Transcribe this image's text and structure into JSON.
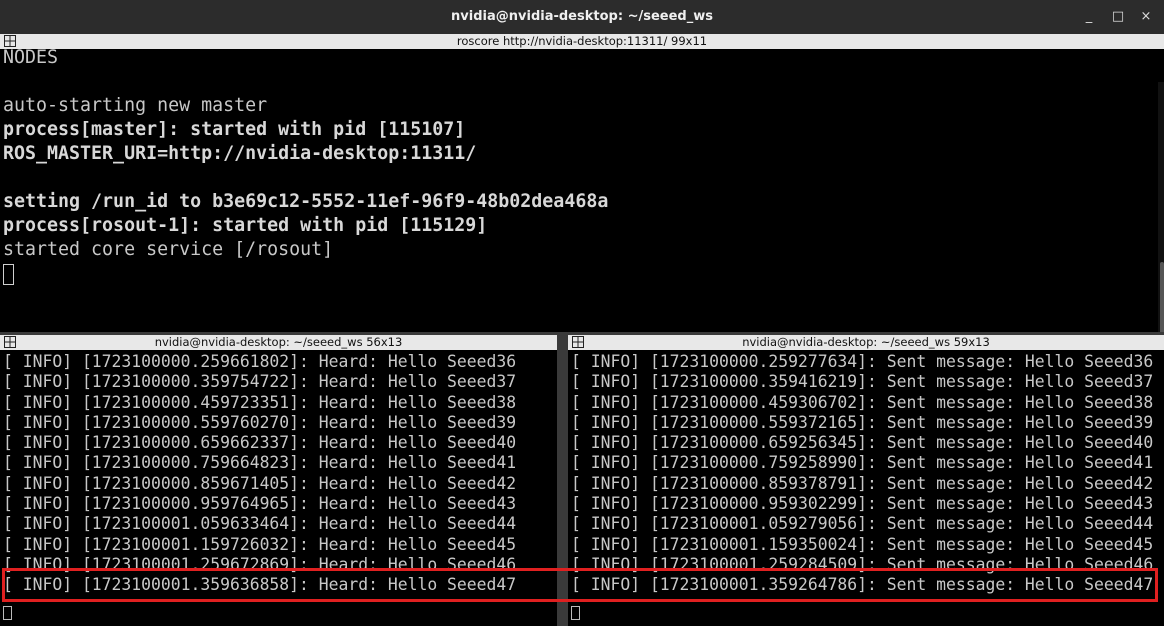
{
  "window": {
    "title": "nvidia@nvidia-desktop: ~/seeed_ws",
    "buttons": {
      "close": "×",
      "minimize": "_",
      "maximize": "□"
    }
  },
  "panes": {
    "top": {
      "header": "roscore http://nvidia-desktop:11311/ 99x11",
      "lines": [
        {
          "text": "NODES",
          "bold": false
        },
        {
          "text": "",
          "bold": false
        },
        {
          "text": "auto-starting new master",
          "bold": false
        },
        {
          "text": "process[master]: started with pid [115107]",
          "bold": true
        },
        {
          "text": "ROS_MASTER_URI=http://nvidia-desktop:11311/",
          "bold": true
        },
        {
          "text": "",
          "bold": false
        },
        {
          "text": "setting /run_id to b3e69c12-5552-11ef-96f9-48b02dea468a",
          "bold": true
        },
        {
          "text": "process[rosout-1]: started with pid [115129]",
          "bold": true
        },
        {
          "text": "started core service [/rosout]",
          "bold": false
        }
      ]
    },
    "left": {
      "header": "nvidia@nvidia-desktop: ~/seeed_ws 56x13",
      "lines": [
        "[ INFO] [1723100000.259661802]: Heard: Hello Seeed36",
        "[ INFO] [1723100000.359754722]: Heard: Hello Seeed37",
        "[ INFO] [1723100000.459723351]: Heard: Hello Seeed38",
        "[ INFO] [1723100000.559760270]: Heard: Hello Seeed39",
        "[ INFO] [1723100000.659662337]: Heard: Hello Seeed40",
        "[ INFO] [1723100000.759664823]: Heard: Hello Seeed41",
        "[ INFO] [1723100000.859671405]: Heard: Hello Seeed42",
        "[ INFO] [1723100000.959764965]: Heard: Hello Seeed43",
        "[ INFO] [1723100001.059633464]: Heard: Hello Seeed44",
        "[ INFO] [1723100001.159726032]: Heard: Hello Seeed45",
        "[ INFO] [1723100001.259672869]: Heard: Hello Seeed46",
        "[ INFO] [1723100001.359636858]: Heard: Hello Seeed47"
      ]
    },
    "right": {
      "header": "nvidia@nvidia-desktop: ~/seeed_ws 59x13",
      "lines": [
        "[ INFO] [1723100000.259277634]: Sent message: Hello Seeed36",
        "[ INFO] [1723100000.359416219]: Sent message: Hello Seeed37",
        "[ INFO] [1723100000.459306702]: Sent message: Hello Seeed38",
        "[ INFO] [1723100000.559372165]: Sent message: Hello Seeed39",
        "[ INFO] [1723100000.659256345]: Sent message: Hello Seeed40",
        "[ INFO] [1723100000.759258990]: Sent message: Hello Seeed41",
        "[ INFO] [1723100000.859378791]: Sent message: Hello Seeed42",
        "[ INFO] [1723100000.959302299]: Sent message: Hello Seeed43",
        "[ INFO] [1723100001.059279056]: Sent message: Hello Seeed44",
        "[ INFO] [1723100001.159350024]: Sent message: Hello Seeed45",
        "[ INFO] [1723100001.259284509]: Sent message: Hello Seeed46",
        "[ INFO] [1723100001.359264786]: Sent message: Hello Seeed47"
      ]
    }
  },
  "colors": {
    "highlight": "#e02020",
    "terminal_bg": "#000000",
    "header_bg": "#e8e8e8"
  },
  "icons": {
    "pane_icon": "grid-icon"
  }
}
